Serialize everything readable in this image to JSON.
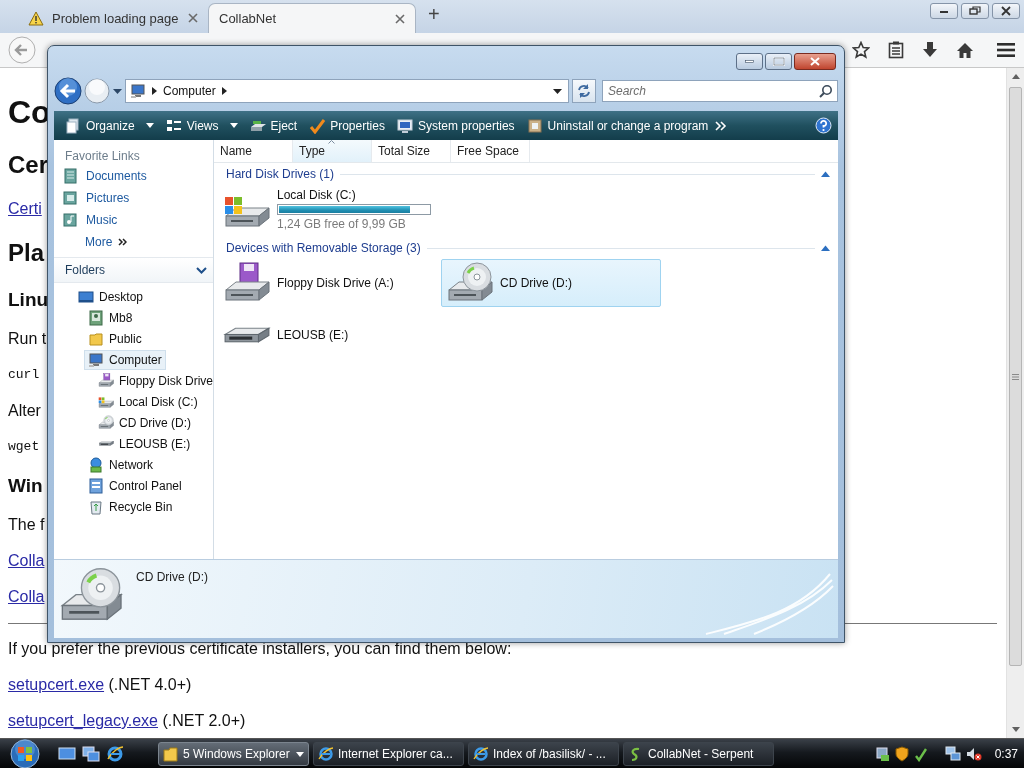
{
  "browser": {
    "tabs": [
      {
        "label": "Problem loading page",
        "kind": "warning",
        "selected": false
      },
      {
        "label": "CollabNet",
        "kind": "page",
        "selected": true
      }
    ],
    "new_tab": "+"
  },
  "page": {
    "blocks": [
      {
        "kind": "h1",
        "text": "Co"
      },
      {
        "kind": "h2",
        "text": "Cer"
      },
      {
        "kind": "link",
        "text": "Certi"
      },
      {
        "kind": "h2",
        "text": "Pla"
      },
      {
        "kind": "h3",
        "text": "Linu"
      },
      {
        "kind": "p",
        "text": "Run t"
      },
      {
        "kind": "code",
        "text": "curl"
      },
      {
        "kind": "p",
        "text": "Alter"
      },
      {
        "kind": "code",
        "text": "wget"
      },
      {
        "kind": "h3",
        "text": "Win"
      },
      {
        "kind": "p",
        "text": "The f"
      },
      {
        "kind": "link",
        "text": "Colla"
      },
      {
        "kind": "link",
        "text": "Colla"
      },
      {
        "kind": "hr"
      },
      {
        "kind": "p",
        "text": "If you prefer the previous certificate installers, you can find them below:"
      },
      {
        "kind": "linkline",
        "link": "setupcert.exe",
        "text": "(.NET 4.0+)"
      },
      {
        "kind": "linkline",
        "link": "setupcert_legacy.exe",
        "text": "(.NET 2.0+)"
      }
    ]
  },
  "explorer": {
    "breadcrumb": [
      "Computer"
    ],
    "search": {
      "placeholder": "Search"
    },
    "toolbar": [
      {
        "label": "Organize",
        "kind": "organize",
        "menu": true
      },
      {
        "label": "Views",
        "kind": "views",
        "menu": true
      },
      {
        "label": "Eject",
        "kind": "eject",
        "menu": false
      },
      {
        "label": "Properties",
        "kind": "properties",
        "menu": false
      },
      {
        "label": "System properties",
        "kind": "system",
        "menu": false
      },
      {
        "label": "Uninstall or change a program",
        "kind": "uninstall",
        "menu": false
      }
    ],
    "favorite_links": {
      "title": "Favorite Links",
      "items": [
        {
          "label": "Documents",
          "kind": "documents"
        },
        {
          "label": "Pictures",
          "kind": "pictures"
        },
        {
          "label": "Music",
          "kind": "music"
        }
      ],
      "more": "More"
    },
    "folders": {
      "title": "Folders",
      "expanded": true,
      "tree": [
        {
          "label": "Desktop",
          "kind": "desktop",
          "selected": false,
          "children": [
            {
              "label": "Mb8",
              "kind": "user",
              "selected": false
            },
            {
              "label": "Public",
              "kind": "folder",
              "selected": false
            },
            {
              "label": "Computer",
              "kind": "computer",
              "selected": true,
              "children": [
                {
                  "label": "Floppy Disk Drive",
                  "kind": "floppy",
                  "selected": false
                },
                {
                  "label": "Local Disk (C:)",
                  "kind": "hdd",
                  "selected": false
                },
                {
                  "label": "CD Drive (D:)",
                  "kind": "cd",
                  "selected": false
                },
                {
                  "label": "LEOUSB (E:)",
                  "kind": "usb",
                  "selected": false
                }
              ]
            },
            {
              "label": "Network",
              "kind": "network",
              "selected": false
            },
            {
              "label": "Control Panel",
              "kind": "control",
              "selected": false
            },
            {
              "label": "Recycle Bin",
              "kind": "recycle",
              "selected": false
            }
          ]
        }
      ]
    },
    "columns": [
      {
        "label": "Name",
        "sorted": false
      },
      {
        "label": "Type",
        "sorted": true
      },
      {
        "label": "Total Size",
        "sorted": false
      },
      {
        "label": "Free Space",
        "sorted": false
      }
    ],
    "groups": [
      {
        "title": "Hard Disk Drives (1)",
        "expanded": true,
        "items": [
          {
            "name": "Local Disk (C:)",
            "kind": "hdd",
            "selected": false,
            "level": 0.876,
            "detail": "1,24 GB free of 9,99 GB"
          }
        ]
      },
      {
        "title": "Devices with Removable Storage (3)",
        "expanded": true,
        "items": [
          {
            "name": "Floppy Disk Drive (A:)",
            "kind": "floppy",
            "selected": false
          },
          {
            "name": "CD Drive (D:)",
            "kind": "cd",
            "selected": true
          },
          {
            "name": "LEOUSB (E:)",
            "kind": "usb",
            "selected": false
          }
        ]
      }
    ],
    "details": {
      "name": "CD Drive (D:)",
      "kind": "cd"
    }
  },
  "taskbar": {
    "tasks": [
      {
        "label": "5 Windows Explorer",
        "kind": "explorer",
        "selected": true,
        "menu": true
      },
      {
        "label": "Internet Explorer ca...",
        "kind": "ie",
        "selected": false,
        "menu": false
      },
      {
        "label": "Index of /basilisk/ - ...",
        "kind": "ie",
        "selected": false,
        "menu": false
      },
      {
        "label": "CollabNet - Serpent",
        "kind": "serpent",
        "selected": false,
        "menu": false
      }
    ],
    "clock": "0:37"
  }
}
